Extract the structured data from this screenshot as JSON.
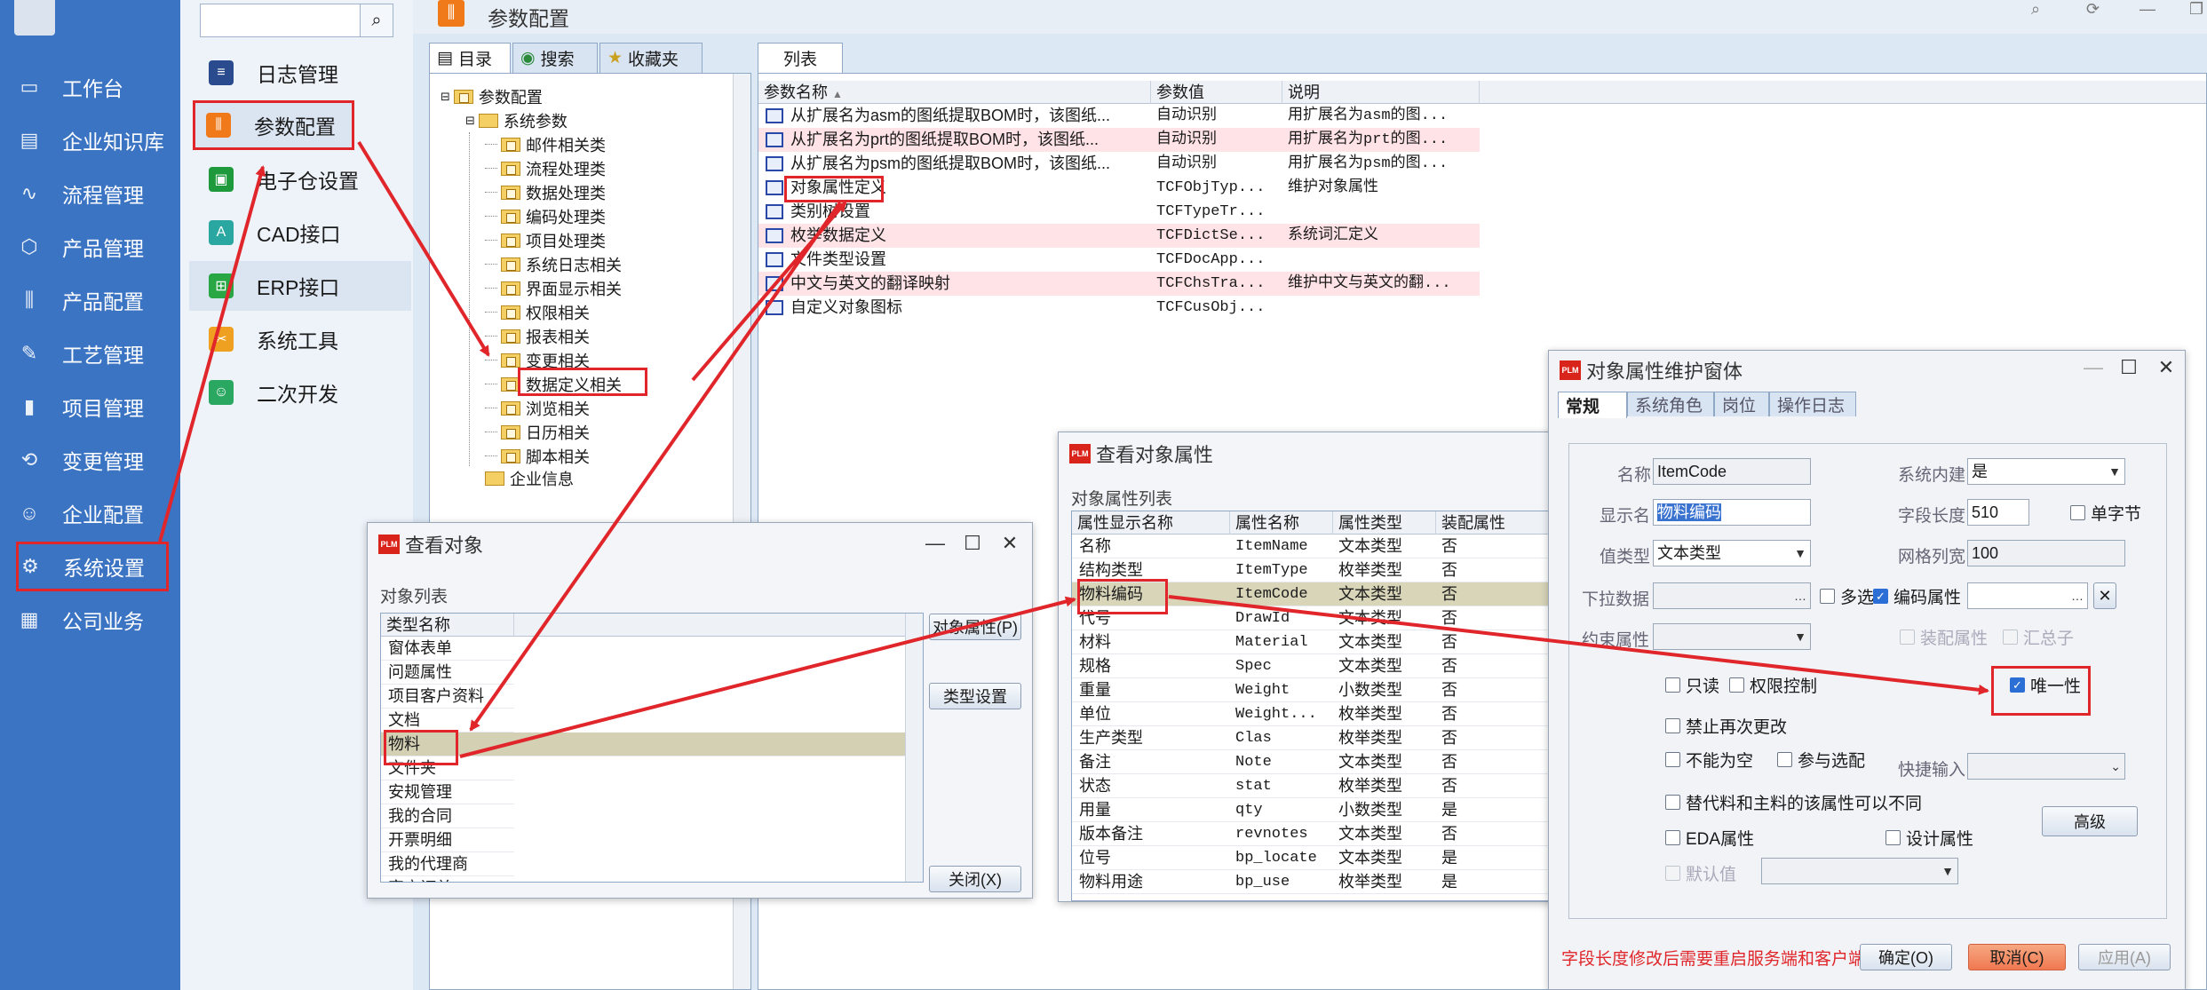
{
  "nav": {
    "items": [
      {
        "label": "工作台",
        "icon": "monitor-icon"
      },
      {
        "label": "企业知识库",
        "icon": "book-icon"
      },
      {
        "label": "流程管理",
        "icon": "flow-icon"
      },
      {
        "label": "产品管理",
        "icon": "cube-icon"
      },
      {
        "label": "产品配置",
        "icon": "sliders-icon"
      },
      {
        "label": "工艺管理",
        "icon": "wrench-icon"
      },
      {
        "label": "项目管理",
        "icon": "chart-icon"
      },
      {
        "label": "变更管理",
        "icon": "change-icon"
      },
      {
        "label": "企业配置",
        "icon": "people-icon"
      },
      {
        "label": "系统设置",
        "icon": "gear-icon"
      },
      {
        "label": "公司业务",
        "icon": "grid-icon"
      }
    ]
  },
  "submenu": {
    "items": [
      {
        "label": "日志管理",
        "color": "#2a4b8d"
      },
      {
        "label": "参数配置",
        "color": "#f07a1a"
      },
      {
        "label": "电子仓设置",
        "color": "#1e9a3c"
      },
      {
        "label": "CAD接口",
        "color": "#2aa7a0"
      },
      {
        "label": "ERP接口",
        "color": "#2aa745"
      },
      {
        "label": "系统工具",
        "color": "#f0a020"
      },
      {
        "label": "二次开发",
        "color": "#2aa760"
      }
    ]
  },
  "header": {
    "title": "参数配置"
  },
  "left_tabs": [
    "目录",
    "搜索",
    "收藏夹"
  ],
  "tree": {
    "root": "参数配置",
    "group": "系统参数",
    "children": [
      "邮件相关类",
      "流程处理类",
      "数据处理类",
      "编码处理类",
      "项目处理类",
      "系统日志相关",
      "界面显示相关",
      "权限相关",
      "报表相关",
      "变更相关",
      "数据定义相关",
      "浏览相关",
      "日历相关",
      "脚本相关"
    ],
    "sibling": "企业信息"
  },
  "list_tab": "列表",
  "param_grid": {
    "headers": [
      "参数名称",
      "参数值",
      "说明"
    ],
    "rows": [
      [
        "从扩展名为asm的图纸提取BOM时，该图纸...",
        "自动识别",
        "用扩展名为asm的图..."
      ],
      [
        "从扩展名为prt的图纸提取BOM时，该图纸...",
        "自动识别",
        "用扩展名为prt的图..."
      ],
      [
        "从扩展名为psm的图纸提取BOM时，该图纸...",
        "自动识别",
        "用扩展名为psm的图..."
      ],
      [
        "对象属性定义",
        "TCFObjTyp...",
        "维护对象属性"
      ],
      [
        "类别树设置",
        "TCFTypeTr...",
        ""
      ],
      [
        "枚举数据定义",
        "TCFDictSe...",
        "系统词汇定义"
      ],
      [
        "文件类型设置",
        "TCFDocApp...",
        ""
      ],
      [
        "中文与英文的翻译映射",
        "TCFChsTra...",
        "维护中文与英文的翻..."
      ],
      [
        "自定义对象图标",
        "TCFCusObj...",
        ""
      ]
    ]
  },
  "view_object": {
    "title": "查看对象",
    "list_label": "对象列表",
    "header": "类型名称",
    "rows": [
      "窗体表单",
      "问题属性",
      "项目客户资料",
      "文档",
      "物料",
      "文件夹",
      "安规管理",
      "我的合同",
      "开票明细",
      "我的代理商",
      "客户订单"
    ],
    "buttons": [
      "对象属性(P)",
      "类型设置",
      "关闭(X)"
    ]
  },
  "view_attr": {
    "title": "查看对象属性",
    "list_label": "对象属性列表",
    "headers": [
      "属性显示名称",
      "属性名称",
      "属性类型",
      "装配属性"
    ],
    "rows": [
      [
        "名称",
        "ItemName",
        "文本类型",
        "否"
      ],
      [
        "结构类型",
        "ItemType",
        "枚举类型",
        "否"
      ],
      [
        "物料编码",
        "ItemCode",
        "文本类型",
        "否"
      ],
      [
        "代号",
        "DrawId",
        "文本类型",
        "否"
      ],
      [
        "材料",
        "Material",
        "文本类型",
        "否"
      ],
      [
        "规格",
        "Spec",
        "文本类型",
        "否"
      ],
      [
        "重量",
        "Weight",
        "小数类型",
        "否"
      ],
      [
        "单位",
        "Weight...",
        "枚举类型",
        "否"
      ],
      [
        "生产类型",
        "Clas",
        "枚举类型",
        "否"
      ],
      [
        "备注",
        "Note",
        "文本类型",
        "否"
      ],
      [
        "状态",
        "stat",
        "枚举类型",
        "否"
      ],
      [
        "用量",
        "qty",
        "小数类型",
        "是"
      ],
      [
        "版本备注",
        "revnotes",
        "文本类型",
        "否"
      ],
      [
        "位号",
        "bp_locate",
        "文本类型",
        "是"
      ],
      [
        "物料用途",
        "bp_use",
        "枚举类型",
        "是"
      ]
    ]
  },
  "maint": {
    "title": "对象属性维护窗体",
    "tabs": [
      "常规",
      "系统角色",
      "岗位",
      "操作日志"
    ],
    "fields": {
      "name_label": "名称",
      "name_value": "ItemCode",
      "builtin_label": "系统内建",
      "builtin_value": "是",
      "display_label": "显示名",
      "display_value": "物料编码",
      "length_label": "字段长度",
      "length_value": "510",
      "single_byte": "单字节",
      "valtype_label": "值类型",
      "valtype_value": "文本类型",
      "gridwidth_label": "网格列宽",
      "gridwidth_value": "100",
      "dropdown_label": "下拉数据",
      "multi": "多选",
      "code_attr": "编码属性",
      "constraint_label": "约束属性",
      "assembly": "装配属性",
      "summary": "汇总子",
      "readonly": "只读",
      "perm": "权限控制",
      "unique": "唯一性",
      "no_change": "禁止再次更改",
      "not_null": "不能为空",
      "match": "参与选配",
      "quick_label": "快捷输入",
      "substitute": "替代料和主料的该属性可以不同",
      "advanced": "高级",
      "eda": "EDA属性",
      "design": "设计属性",
      "default_label": "默认值"
    },
    "warning": "字段长度修改后需要重启服务端和客户端",
    "buttons": [
      "确定(O)",
      "取消(C)",
      "应用(A)"
    ]
  }
}
